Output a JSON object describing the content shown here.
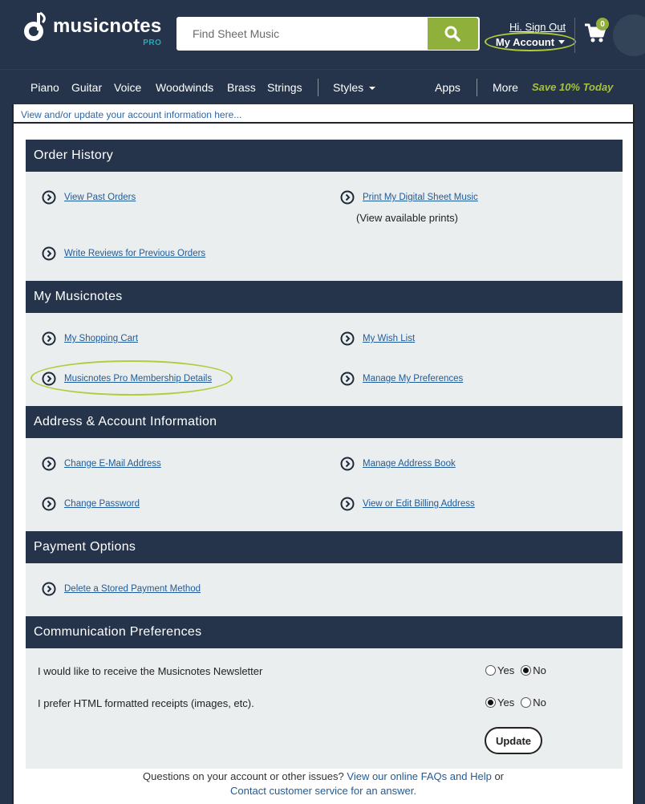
{
  "header": {
    "logo_text": "musicnotes",
    "logo_badge": "PRO",
    "search_placeholder": "Find Sheet Music",
    "greeting": "Hi. Sign Out",
    "account_label": "My Account",
    "cart_count": "0"
  },
  "nav": {
    "items": [
      "Piano",
      "Guitar",
      "Voice",
      "Woodwinds",
      "Brass",
      "Strings"
    ],
    "styles": "Styles",
    "apps": "Apps",
    "more": "More",
    "promo": "Save 10% Today"
  },
  "intro": "View and/or update your account information here...",
  "sections": {
    "order_history": {
      "title": "Order History",
      "view_past_orders": "View Past Orders",
      "print_digital": "Print My Digital Sheet Music",
      "print_note": "(View available prints)",
      "write_reviews": "Write Reviews for Previous Orders"
    },
    "my_musicnotes": {
      "title": "My Musicnotes",
      "shopping_cart": "My Shopping Cart",
      "wish_list": "My Wish List",
      "pro_membership": "Musicnotes Pro Membership Details",
      "preferences": "Manage My Preferences"
    },
    "address": {
      "title": "Address & Account Information",
      "change_email": "Change E-Mail Address",
      "address_book": "Manage Address Book",
      "change_password": "Change Password",
      "billing": "View or Edit Billing Address"
    },
    "payment": {
      "title": "Payment Options",
      "delete_payment": "Delete a Stored Payment Method"
    },
    "communication": {
      "title": "Communication Preferences",
      "newsletter_label": "I would like to receive the Musicnotes Newsletter",
      "newsletter_value": "No",
      "html_label": "I prefer HTML formatted receipts (images, etc).",
      "html_value": "Yes",
      "yes": "Yes",
      "no": "No",
      "update": "Update"
    }
  },
  "footer": {
    "question": "Questions on your account or other issues?",
    "faq_link": "View our online FAQs and Help",
    "or": "or",
    "contact_link": "Contact customer service for an answer."
  },
  "colors": {
    "header_bg": "#25344a",
    "accent_green": "#8fb03a",
    "promo_green": "#a7c23a",
    "link_blue": "#1f5b98",
    "section_body": "#ebeeef"
  }
}
